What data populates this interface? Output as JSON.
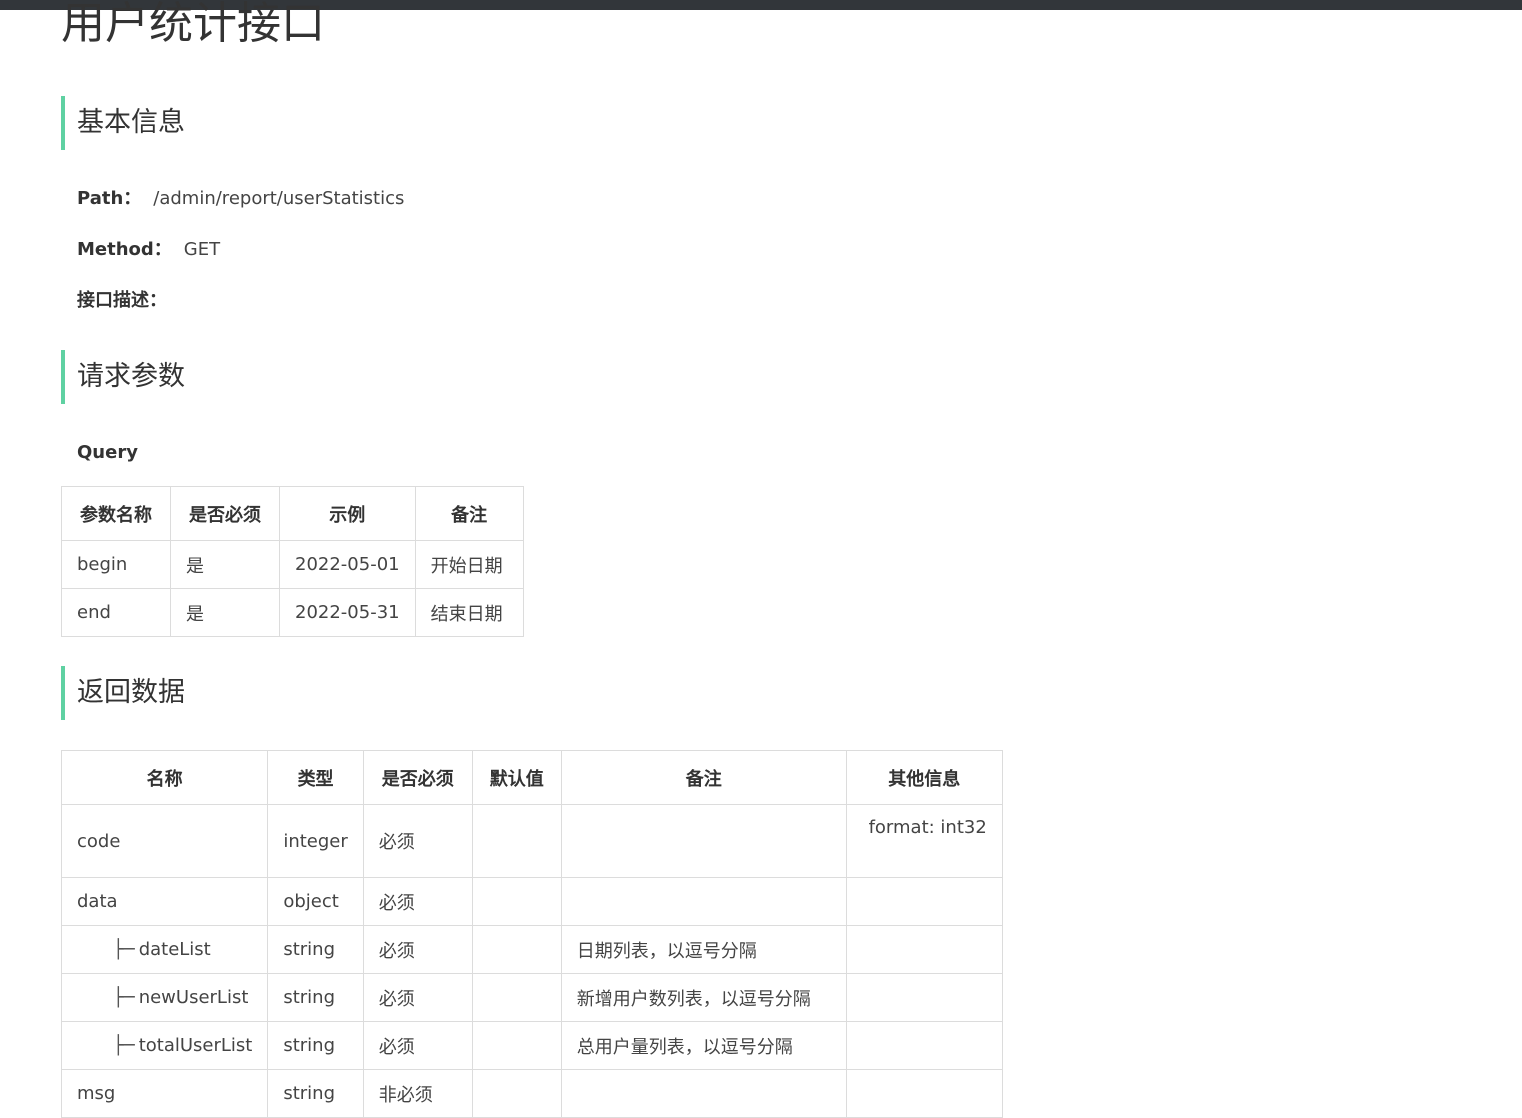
{
  "page": {
    "title": "用户统计接口"
  },
  "basic_info": {
    "heading": "基本信息",
    "path_label": "Path：",
    "path_value": "/admin/report/userStatistics",
    "method_label": "Method：",
    "method_value": "GET",
    "desc_label": "接口描述："
  },
  "request": {
    "heading": "请求参数",
    "query_label": "Query",
    "columns": [
      "参数名称",
      "是否必须",
      "示例",
      "备注"
    ],
    "rows": [
      {
        "name": "begin",
        "required": "是",
        "example": "2022-05-01",
        "note": "开始日期"
      },
      {
        "name": "end",
        "required": "是",
        "example": "2022-05-31",
        "note": "结束日期"
      }
    ]
  },
  "response": {
    "heading": "返回数据",
    "tree_glyph": "├─",
    "columns": [
      "名称",
      "类型",
      "是否必须",
      "默认值",
      "备注",
      "其他信息"
    ],
    "rows": [
      {
        "name": "code",
        "type": "integer",
        "required": "必须",
        "default": "",
        "note": "",
        "other": "format: int32"
      },
      {
        "name": "data",
        "type": "object",
        "required": "必须",
        "default": "",
        "note": "",
        "other": ""
      },
      {
        "name": "dateList",
        "type": "string",
        "required": "必须",
        "default": "",
        "note": "日期列表，以逗号分隔",
        "other": ""
      },
      {
        "name": "newUserList",
        "type": "string",
        "required": "必须",
        "default": "",
        "note": "新增用户数列表，以逗号分隔",
        "other": ""
      },
      {
        "name": "totalUserList",
        "type": "string",
        "required": "必须",
        "default": "",
        "note": "总用户量列表，以逗号分隔",
        "other": ""
      },
      {
        "name": "msg",
        "type": "string",
        "required": "非必须",
        "default": "",
        "note": "",
        "other": ""
      }
    ]
  },
  "colors": {
    "accent": "#5fd1a2",
    "topbar": "#32363a",
    "border": "#dcdcdc"
  }
}
